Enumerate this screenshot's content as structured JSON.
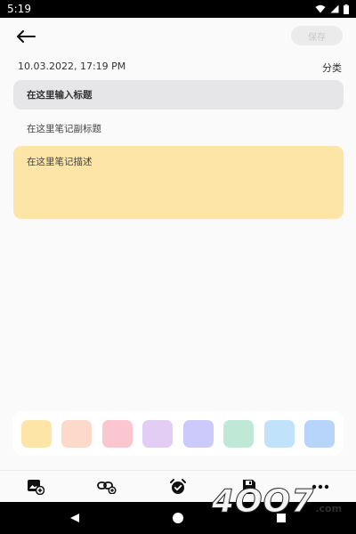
{
  "status_bar": {
    "time": "5:19"
  },
  "header": {
    "save_label": "保存"
  },
  "note": {
    "datetime": "10.03.2022, 17:19 PM",
    "category_label": "分类",
    "title_placeholder": "在这里输入标题",
    "subtitle_placeholder": "在这里笔记副标题",
    "description_placeholder": "在这里笔记描述"
  },
  "palette": {
    "colors": [
      "#fde5a7",
      "#fcd9c8",
      "#fbc6cf",
      "#e3cdf5",
      "#cccafb",
      "#bfe9d6",
      "#c0e3fb",
      "#b7d4fb"
    ]
  },
  "toolbar": {
    "icons": [
      "add-image-icon",
      "link-icon",
      "alarm-icon",
      "save-icon",
      "more-icon"
    ]
  },
  "watermark": {
    "text": "4OO7",
    "suffix": ".com"
  }
}
